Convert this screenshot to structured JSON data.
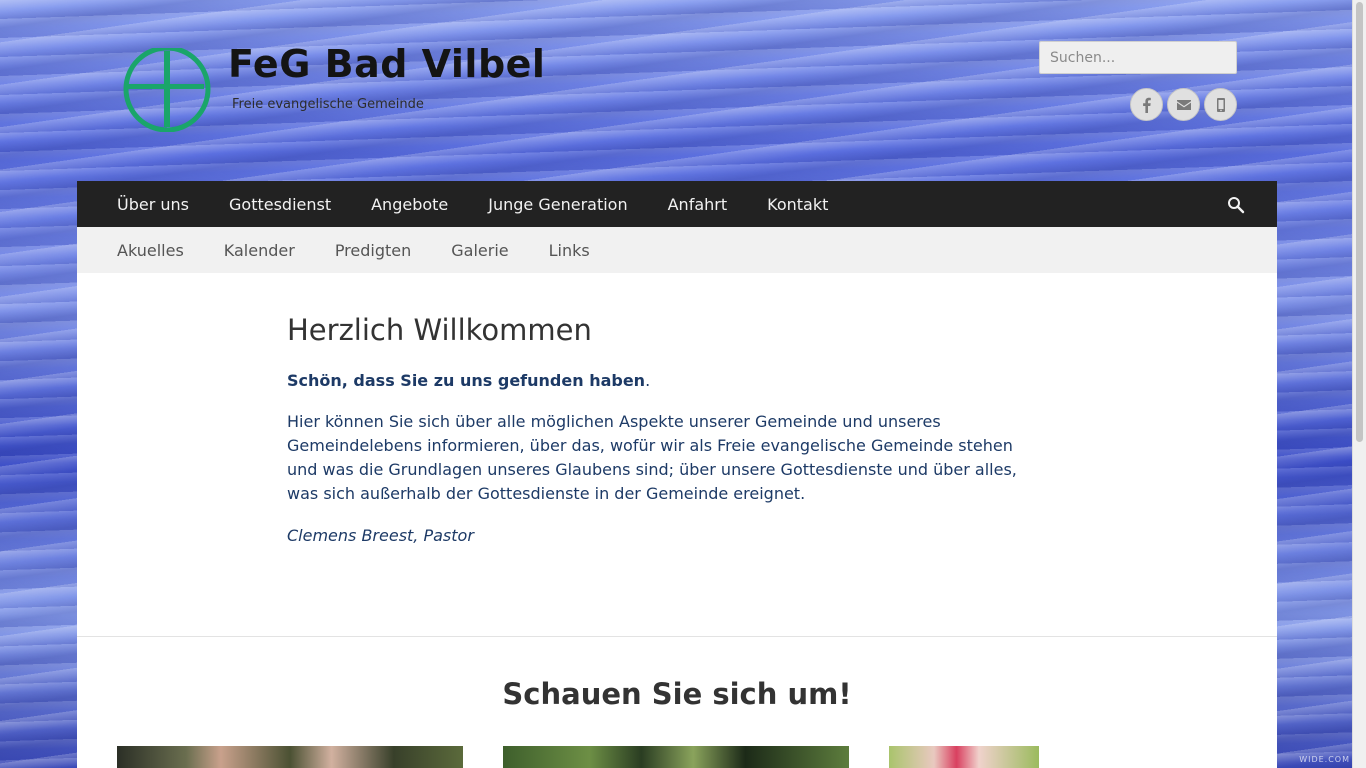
{
  "header": {
    "site_title": "FeG Bad Vilbel",
    "site_description": "Freie evangelische Gemeinde",
    "logo_icon": "cross-in-circle-icon",
    "logo_color": "#1aa56a",
    "search_placeholder": "Suchen...",
    "social_icons": [
      "facebook-icon",
      "mail-icon",
      "mobile-phone-icon"
    ]
  },
  "main_nav": {
    "items": [
      "Über uns",
      "Gottesdienst",
      "Angebote",
      "Junge Generation",
      "Anfahrt",
      "Kontakt"
    ],
    "search_icon": "search-icon"
  },
  "sub_nav": {
    "items": [
      "Akuelles",
      "Kalender",
      "Predigten",
      "Galerie",
      "Links"
    ]
  },
  "welcome": {
    "heading": "Herzlich Willkommen",
    "lead_bold": "Schön, dass Sie zu uns gefunden haben",
    "lead_tail": ".",
    "body": "Hier können Sie sich über alle möglichen Aspekte unserer Gemeinde und unseres Gemeindelebens informieren, über das, wofür wir als Freie evangelische Gemeinde stehen und was die Grundlagen unseres Glaubens sind; über unsere Gottesdienste und über alles, was sich außerhalb der Gottesdienste in der Gemeinde ereignet.",
    "signature": "Clemens Breest, Pastor"
  },
  "explore": {
    "heading": "Schauen Sie sich um!"
  },
  "watermark": "WIDE.COM",
  "colors": {
    "nav_bg": "#222222",
    "subnav_bg": "#f1f1f1",
    "text_blue": "#1d3a66"
  }
}
